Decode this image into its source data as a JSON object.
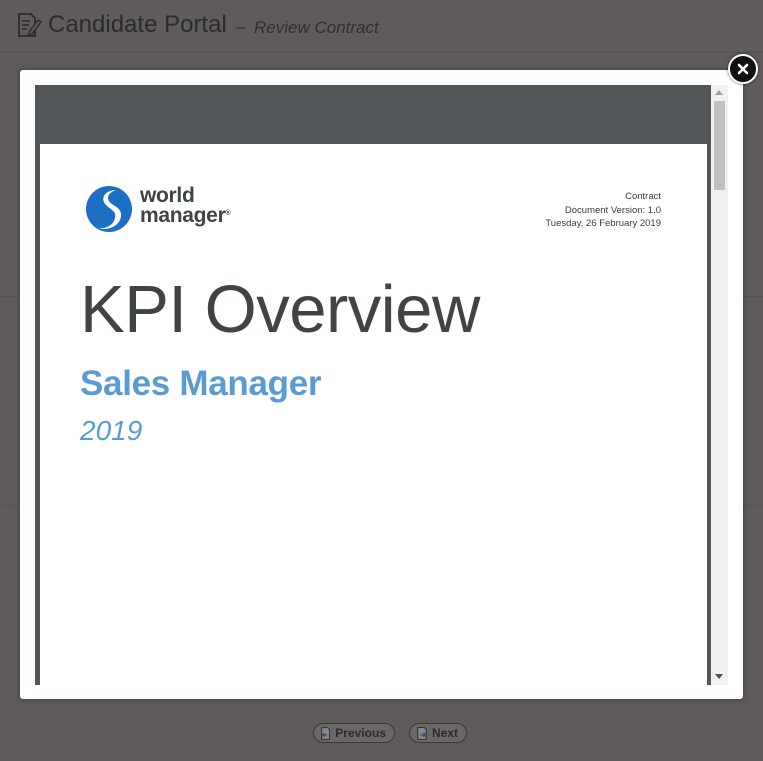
{
  "header": {
    "app_title": "Candidate Portal",
    "separator": "–",
    "subtitle": "Review Contract"
  },
  "footer": {
    "previous_label": "Previous",
    "next_label": "Next"
  },
  "document": {
    "logo_line1": "world",
    "logo_line2": "manager",
    "logo_mark": "®",
    "meta_type": "Contract",
    "meta_version": "Document Version: 1.0",
    "meta_date": "Tuesday, 26 February 2019",
    "title": "KPI Overview",
    "role": "Sales Manager",
    "year": "2019"
  },
  "icons": {
    "header": "edit-document-icon",
    "close": "close-icon",
    "previous": "document-back-icon",
    "next": "document-forward-icon"
  },
  "colors": {
    "overlay": "#5f5b5b",
    "viewer_background": "#525659",
    "accent_blue": "#5b9bd5",
    "logo_blue": "#1d6fc4",
    "title_gray": "#404542"
  }
}
